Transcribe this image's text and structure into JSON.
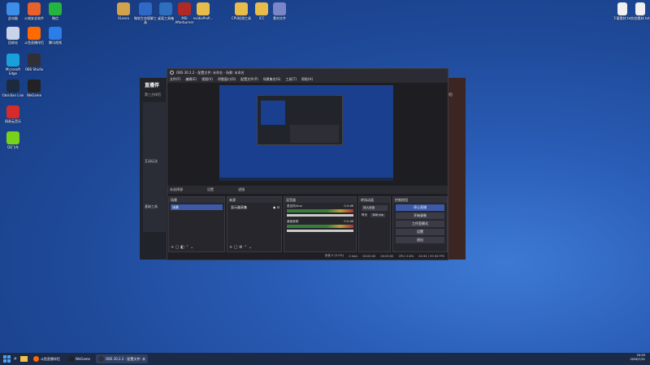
{
  "desktop": {
    "left_icons": [
      {
        "label": "此电脑",
        "color": "#3c8ee8"
      },
      {
        "label": "火绒安全软件",
        "color": "#e8612c"
      },
      {
        "label": "微信",
        "color": "#24b53f"
      },
      {
        "label": "回收站",
        "color": "#c9d4e8"
      },
      {
        "label": "斗鱼直播伴侣",
        "color": "#ff6a00"
      },
      {
        "label": "腾讯视频",
        "color": "#2b7de9"
      },
      {
        "label": "Microsoft Edge",
        "color": "#19a0d8"
      },
      {
        "label": "OBS Studio",
        "color": "#302f36"
      },
      {
        "label": "Obsidian Link",
        "color": "#1c2a3e"
      },
      {
        "label": "WeGame",
        "color": "#222"
      },
      {
        "label": "网易云音乐",
        "color": "#d62b2b"
      },
      {
        "label": "QQ飞车",
        "color": "#79d21a"
      }
    ],
    "top_icons": [
      {
        "label": "XLeara",
        "color": "#d3a24c"
      },
      {
        "label": "微软生态版解工具",
        "color": "#2e69c8"
      },
      {
        "label": "桌面工具箱",
        "color": "#2d6fbe"
      },
      {
        "label": "MSI Afterburner",
        "color": "#b02a25"
      },
      {
        "label": "nvidiaProfi...",
        "color": "#e8bc4a"
      },
      {
        "label": "CPU检测工具",
        "color": "#e8bc4a"
      },
      {
        "label": "ICC",
        "color": "#e8bc4a"
      },
      {
        "label": "素材文件",
        "color": "#7a86c8"
      }
    ],
    "right_icons": [
      {
        "label": "下载素材.txt",
        "color": "#f0f0f0"
      },
      {
        "label": "文档素材.txt",
        "color": "#f0f0f0"
      }
    ]
  },
  "bg_app": {
    "logo": "直播伴",
    "tab": "第三方伴侣",
    "right_label": "伴侣",
    "items": [
      "互动玩法",
      "基础工具"
    ]
  },
  "obs": {
    "title": "OBS 30.2.2 - 配置文件: 未命名 - 场景: 未命名",
    "menus": [
      "文件(F)",
      "编辑(E)",
      "视图(V)",
      "停靠窗口(D)",
      "配置文件(P)",
      "场景集合(S)",
      "工具(T)",
      "帮助(H)"
    ],
    "source_bar": [
      "未选择源",
      "设置",
      "滤镜"
    ],
    "docks": {
      "scenes": {
        "title": "场景",
        "items": [
          "场景"
        ]
      },
      "sources": {
        "title": "来源",
        "items": [
          "显示器采集"
        ]
      },
      "mixer": {
        "title": "混音器",
        "channels": [
          {
            "name": "麦克风/Aux",
            "db": "0.0 dB"
          },
          {
            "name": "桌面音频",
            "db": "0.0 dB"
          }
        ]
      },
      "transitions": {
        "title": "转场动画",
        "type": "淡入淡出",
        "duration_label": "时长",
        "duration": "300 ms"
      },
      "controls": {
        "title": "控制按钮",
        "buttons": [
          "停止直播",
          "开始录制",
          "工作室模式",
          "设置",
          "退出"
        ]
      }
    },
    "status": [
      "丢帧 0 (0.0%)",
      "0 kb/s",
      "00:00:00",
      "00:00:00",
      "CPU: 0.8%",
      "54.94 / 59.94 FPS"
    ]
  },
  "taskbar": {
    "apps": [
      "斗鱼直播伴侣",
      "WeGame",
      "OBS 30.2.2 - 配置文件: 未"
    ],
    "time": "20:59",
    "date": "2026/7/31"
  }
}
